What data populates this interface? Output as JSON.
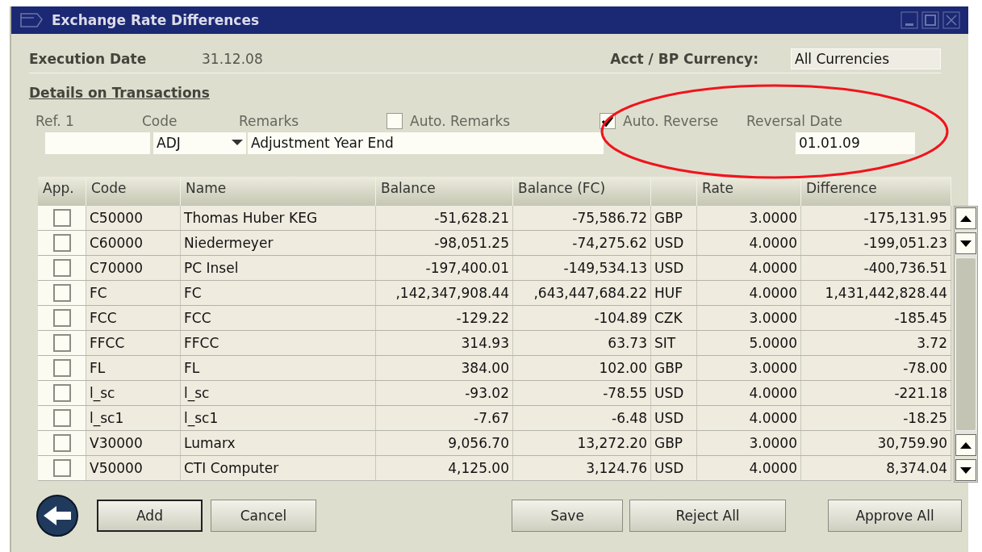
{
  "window": {
    "title": "Exchange Rate Differences"
  },
  "header": {
    "execution_date": {
      "label": "Execution Date",
      "value": "31.12.08"
    },
    "currency": {
      "label": "Acct / BP Currency:",
      "value": "All Currencies"
    }
  },
  "section_title": "Details on Transactions",
  "fields": {
    "ref1": {
      "label": "Ref. 1"
    },
    "code": {
      "label": "Code",
      "value": "ADJ"
    },
    "remarks": {
      "label": "Remarks",
      "value": "Adjustment Year End"
    },
    "auto_remarks": {
      "label": "Auto. Remarks",
      "checked": false
    },
    "auto_reverse": {
      "label": "Auto. Reverse",
      "checked": true
    },
    "reversal_date": {
      "label": "Reversal Date",
      "value": "01.01.09"
    }
  },
  "table": {
    "columns": [
      {
        "kind": "text",
        "label": "App."
      },
      {
        "kind": "text",
        "label": "Code"
      },
      {
        "kind": "text",
        "label": "Name"
      },
      {
        "kind": "text",
        "label": "Balance"
      },
      {
        "kind": "text",
        "label": "Balance (FC)"
      },
      {
        "kind": "blank"
      },
      {
        "kind": "text",
        "label": "Rate"
      },
      {
        "kind": "text",
        "label": "Difference"
      }
    ],
    "rows": [
      {
        "approved": false,
        "code": "C50000",
        "name": "Thomas Huber KEG",
        "balance": "-51,628.21",
        "balance_fc": "-75,586.72",
        "currency": "GBP",
        "rate": "3.0000",
        "difference": "-175,131.95"
      },
      {
        "approved": false,
        "code": "C60000",
        "name": "Niedermeyer",
        "balance": "-98,051.25",
        "balance_fc": "-74,275.62",
        "currency": "USD",
        "rate": "4.0000",
        "difference": "-199,051.23"
      },
      {
        "approved": false,
        "code": "C70000",
        "name": "PC Insel",
        "balance": "-197,400.01",
        "balance_fc": "-149,534.13",
        "currency": "USD",
        "rate": "4.0000",
        "difference": "-400,736.51"
      },
      {
        "approved": false,
        "code": "FC",
        "name": "FC",
        "balance": ",142,347,908.44",
        "balance_fc": ",643,447,684.22",
        "currency": "HUF",
        "rate": "4.0000",
        "difference": "1,431,442,828.44"
      },
      {
        "approved": false,
        "code": "FCC",
        "name": "FCC",
        "balance": "-129.22",
        "balance_fc": "-104.89",
        "currency": "CZK",
        "rate": "3.0000",
        "difference": "-185.45"
      },
      {
        "approved": false,
        "code": "FFCC",
        "name": "FFCC",
        "balance": "314.93",
        "balance_fc": "63.73",
        "currency": "SIT",
        "rate": "5.0000",
        "difference": "3.72"
      },
      {
        "approved": false,
        "code": "FL",
        "name": "FL",
        "balance": "384.00",
        "balance_fc": "102.00",
        "currency": "GBP",
        "rate": "3.0000",
        "difference": "-78.00"
      },
      {
        "approved": false,
        "code": "l_sc",
        "name": "l_sc",
        "balance": "-93.02",
        "balance_fc": "-78.55",
        "currency": "USD",
        "rate": "4.0000",
        "difference": "-221.18"
      },
      {
        "approved": false,
        "code": "l_sc1",
        "name": "l_sc1",
        "balance": "-7.67",
        "balance_fc": "-6.48",
        "currency": "USD",
        "rate": "4.0000",
        "difference": "-18.25"
      },
      {
        "approved": false,
        "code": "V30000",
        "name": "Lumarx",
        "balance": "9,056.70",
        "balance_fc": "13,272.20",
        "currency": "GBP",
        "rate": "3.0000",
        "difference": "30,759.90"
      },
      {
        "approved": false,
        "code": "V50000",
        "name": "CTI Computer",
        "balance": "4,125.00",
        "balance_fc": "3,124.76",
        "currency": "USD",
        "rate": "4.0000",
        "difference": "8,374.04"
      }
    ]
  },
  "buttons_left": [
    {
      "label": "Add",
      "default": true
    },
    {
      "label": "Cancel",
      "default": false
    }
  ],
  "buttons_right": [
    {
      "label": "Save",
      "default": false
    },
    {
      "label": "Reject All",
      "default": false
    },
    {
      "label": "Approve All",
      "default": false
    }
  ]
}
